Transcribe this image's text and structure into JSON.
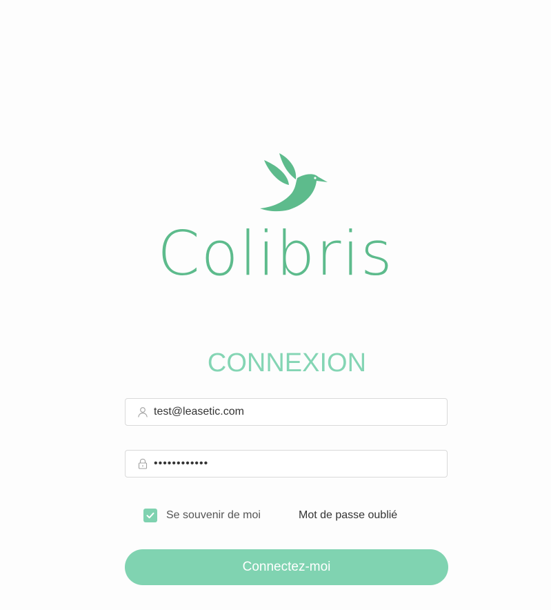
{
  "brand": {
    "name": "Colibris",
    "logo_icon": "hummingbird-icon",
    "color": "#5dbb8c"
  },
  "form": {
    "title": "CONNEXION",
    "email": {
      "icon": "user-icon",
      "value": "test@leasetic.com"
    },
    "password": {
      "icon": "lock-icon",
      "value": "••••••••••••"
    },
    "remember": {
      "label": "Se souvenir de moi",
      "checked": true
    },
    "forgot_label": "Mot de passe oublié",
    "submit_label": "Connectez-moi"
  },
  "colors": {
    "accent": "#80d3b1",
    "title": "#84d5b4",
    "logo": "#5dbb8c"
  }
}
